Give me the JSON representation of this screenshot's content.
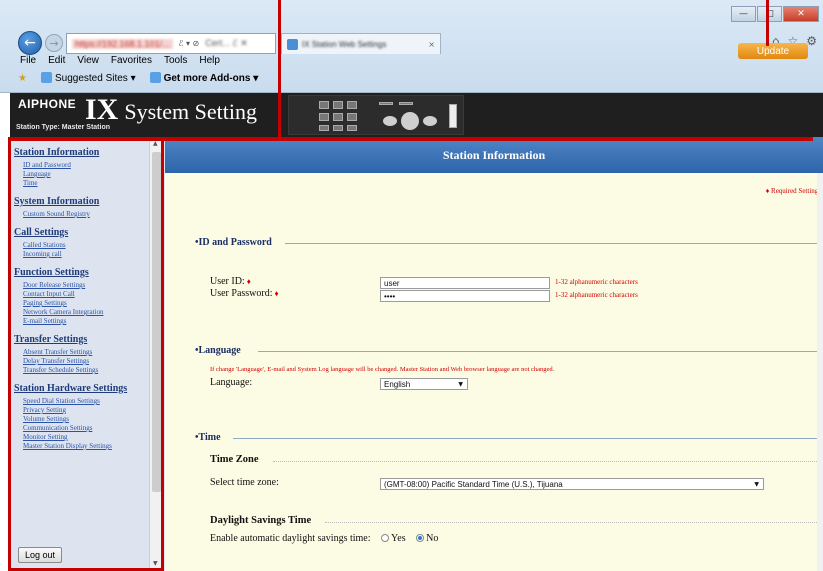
{
  "browser": {
    "address_url": "https://192.168.1.101/...",
    "address_controls": "ℰ ▾ ⊘",
    "address_cert": "Cert... ℰ ✕",
    "tab_title": "IX Station Web Settings",
    "menu": [
      "File",
      "Edit",
      "View",
      "Favorites",
      "Tools",
      "Help"
    ],
    "favorites": [
      "Suggested Sites ▾",
      "Get more Add-ons ▾"
    ]
  },
  "app_header": {
    "brand": "AIPHONE",
    "title_ix": "IX",
    "title_rest": "System Setting",
    "station_type": "Station Type:  Master Station",
    "update_label": "Update"
  },
  "sidebar": {
    "groups": [
      {
        "title": "Station Information",
        "links": [
          "ID and Password",
          "Language",
          "Time"
        ]
      },
      {
        "title": "System Information",
        "links": [
          "Custom Sound Registry"
        ]
      },
      {
        "title": "Call Settings",
        "links": [
          "Called Stations",
          "Incoming call"
        ]
      },
      {
        "title": "Function Settings",
        "links": [
          "Door Release Settings",
          "Contact Input Call",
          "Paging Settings",
          "Network Camera Integration",
          "E-mail Settings"
        ]
      },
      {
        "title": "Transfer Settings",
        "links": [
          "Absent Transfer Settings",
          "Delay Transfer Settings",
          "Transfer Schedule Settings"
        ]
      },
      {
        "title": "Station Hardware Settings",
        "links": [
          "Speed Dial Station Settings",
          "Privacy Setting",
          "Volume Settings",
          "Communication Settings",
          "Monitor Setting",
          "Master Station Display Settings"
        ]
      }
    ],
    "logout_label": "Log out"
  },
  "main": {
    "page_title": "Station Information",
    "required_note": "♦  Required Settings",
    "id_section": {
      "title": "•ID and Password",
      "user_id_label": "User ID:",
      "user_id_value": "user",
      "user_id_hint": "1-32 alphanumeric characters",
      "password_label": "User Password:",
      "password_value": "••••",
      "password_hint": "1-32 alphanumeric characters",
      "required_mark": "♦"
    },
    "language_section": {
      "title": "•Language",
      "warning": "If change 'Language', E-mail and System Log language will be changed. Master Station and Web browser language are not changed.",
      "label": "Language:",
      "value": "English"
    },
    "time_section": {
      "title": "•Time",
      "timezone_heading": "Time Zone",
      "timezone_label": "Select time zone:",
      "timezone_value": "(GMT-08:00) Pacific Standard Time (U.S.), Tijuana",
      "dst_heading": "Daylight Savings Time",
      "dst_label": "Enable automatic daylight savings time:",
      "dst_yes": "Yes",
      "dst_no": "No",
      "dst_selected": "No"
    }
  },
  "colors": {
    "annotation": "#c40000",
    "header_blue": "#3a72b8",
    "required_red": "#d10000",
    "content_bg": "#fcfbe3",
    "update_orange": "#ef9d2a"
  }
}
